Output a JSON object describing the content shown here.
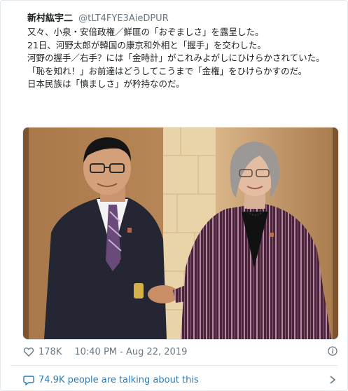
{
  "tweet": {
    "display_name": "新村紘宇二",
    "handle": "@tLT4FYE3AieDPUR",
    "lines": [
      "又々、小泉・安倍政権／鮮匪の「おぞましさ」を露呈した。",
      "21日、河野太郎が韓国の康京和外相と「握手」を交わした。",
      "河野の握手／右手？には「金時計」がこれみよがしにひけらかされていた。",
      "「恥を知れ！」お前達はどうしてこうまで「金権」をひけらかすのだ。",
      "日本民族は「慎ましさ」が矜持なのだ。"
    ],
    "likes": "178K",
    "timestamp": "10:40 PM - Aug 22, 2019",
    "talking": "74.9K people are talking about this"
  },
  "icons": {
    "like": "heart-icon",
    "info": "info-icon",
    "talking": "speech-bubble-icon",
    "more": "chevron-right-icon"
  },
  "colors": {
    "link": "#2b7bb9",
    "muted": "#697882",
    "text": "#1c2022",
    "border": "#e1e8ed"
  }
}
